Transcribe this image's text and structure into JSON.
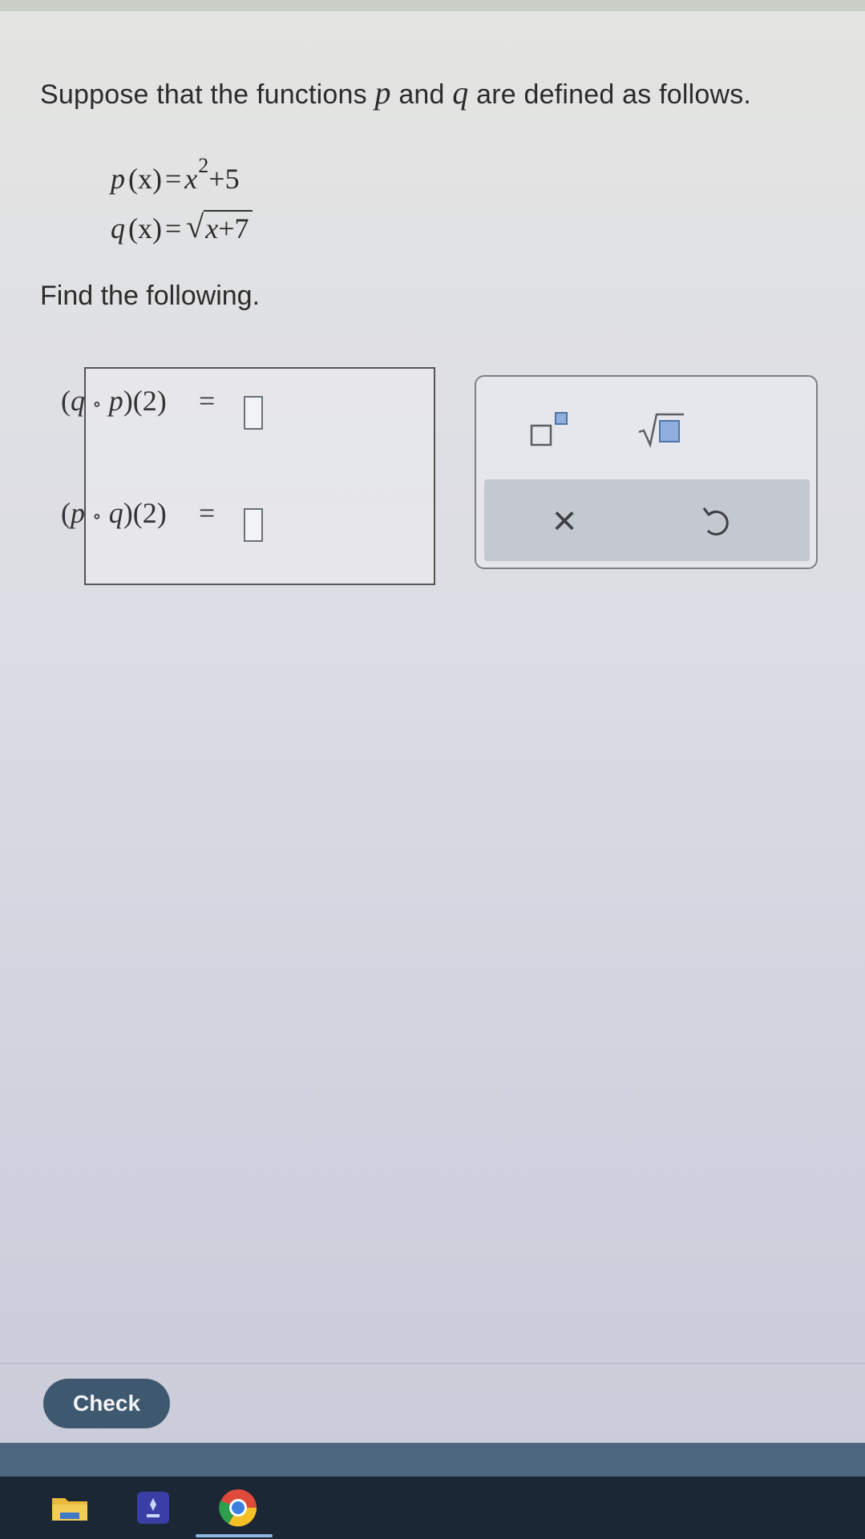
{
  "prompt": {
    "before_p": "Suppose that the functions ",
    "p": "p",
    "middle": " and ",
    "q": "q",
    "after_q": " are defined as follows."
  },
  "definitions": {
    "p_lhs": "p",
    "p_arg": "(x)",
    "p_eq": "=",
    "p_base": "x",
    "p_exp": "2",
    "p_tail": "+5",
    "q_lhs": "q",
    "q_arg": "(x)",
    "q_eq": "=",
    "q_sqrt": "√",
    "q_radicand_var": "x",
    "q_radicand_rest": "+7"
  },
  "instruction": "Find the following.",
  "answers": [
    {
      "outer": "q",
      "circ": "∘",
      "inner": "p",
      "arg": "(2)",
      "eq": "=",
      "value": ""
    },
    {
      "outer": "p",
      "circ": "∘",
      "inner": "q",
      "arg": "(2)",
      "eq": "=",
      "value": ""
    }
  ],
  "tools": {
    "exponent_icon": "superscript-template-icon",
    "sqrt_icon": "square-root-template-icon",
    "clear_glyph": "×",
    "undo_glyph": "↺"
  },
  "check_label": "Check",
  "taskbar": {
    "file_explorer_icon": "folder-icon",
    "app_icon": "app-icon",
    "chrome_icon": "chrome-icon"
  },
  "colors": {
    "check_button": "#3e5870",
    "footer_band": "#4d6780",
    "taskbar": "#1c2735"
  }
}
